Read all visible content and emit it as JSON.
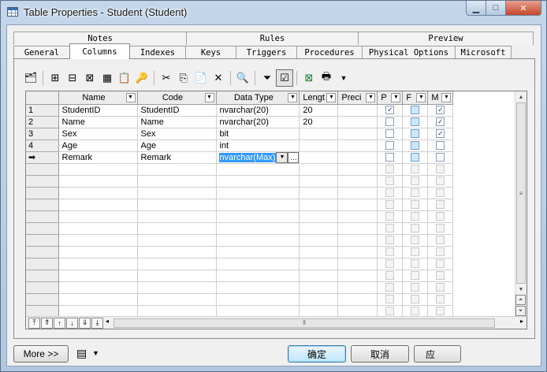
{
  "window": {
    "title": "Table Properties - Student (Student)"
  },
  "tabs": {
    "row_top": [
      "Notes",
      "Rules",
      "Preview"
    ],
    "row_bottom": [
      "General",
      "Columns",
      "Indexes",
      "Keys",
      "Triggers",
      "Procedures",
      "Physical Options",
      "Microsoft"
    ],
    "active": "Columns"
  },
  "toolbar_icons": [
    "properties-icon",
    "insert-row-icon",
    "add-row-icon",
    "insert-column-icon",
    "add-column-icon",
    "copy-attributes-icon",
    "key-icon",
    "cut-icon",
    "copy-icon",
    "paste-icon",
    "delete-icon",
    "find-icon",
    "filter-icon",
    "customize-columns-icon",
    "excel-export-icon",
    "print-icon",
    "dropdown-arrow-icon"
  ],
  "grid": {
    "columns": [
      "Name",
      "Code",
      "Data Type",
      "Lengt",
      "Preci",
      "P",
      "F",
      "M"
    ],
    "rows": [
      {
        "num": "1",
        "name": "StudentID",
        "code": "StudentID",
        "type": "nvarchar(20)",
        "length": "20",
        "precision": "",
        "p": true,
        "f": false,
        "m": true
      },
      {
        "num": "2",
        "name": "Name",
        "code": "Name",
        "type": "nvarchar(20)",
        "length": "20",
        "precision": "",
        "p": false,
        "f": false,
        "m": true
      },
      {
        "num": "3",
        "name": "Sex",
        "code": "Sex",
        "type": "bit",
        "length": "",
        "precision": "",
        "p": false,
        "f": false,
        "m": true
      },
      {
        "num": "4",
        "name": "Age",
        "code": "Age",
        "type": "int",
        "length": "",
        "precision": "",
        "p": false,
        "f": false,
        "m": false
      },
      {
        "num": "➡",
        "name": "Remark",
        "code": "Remark",
        "type": "nvarchar(Max)",
        "length": "",
        "precision": "",
        "p": false,
        "f": false,
        "m": false,
        "editing": true
      }
    ],
    "empty_rows": 13
  },
  "nav_buttons": [
    "move-top",
    "move-up-page",
    "move-up",
    "move-down",
    "move-down-page",
    "move-bottom"
  ],
  "buttons": {
    "more": "More >>",
    "ok": "确定",
    "cancel": "取消",
    "apply": "应"
  }
}
